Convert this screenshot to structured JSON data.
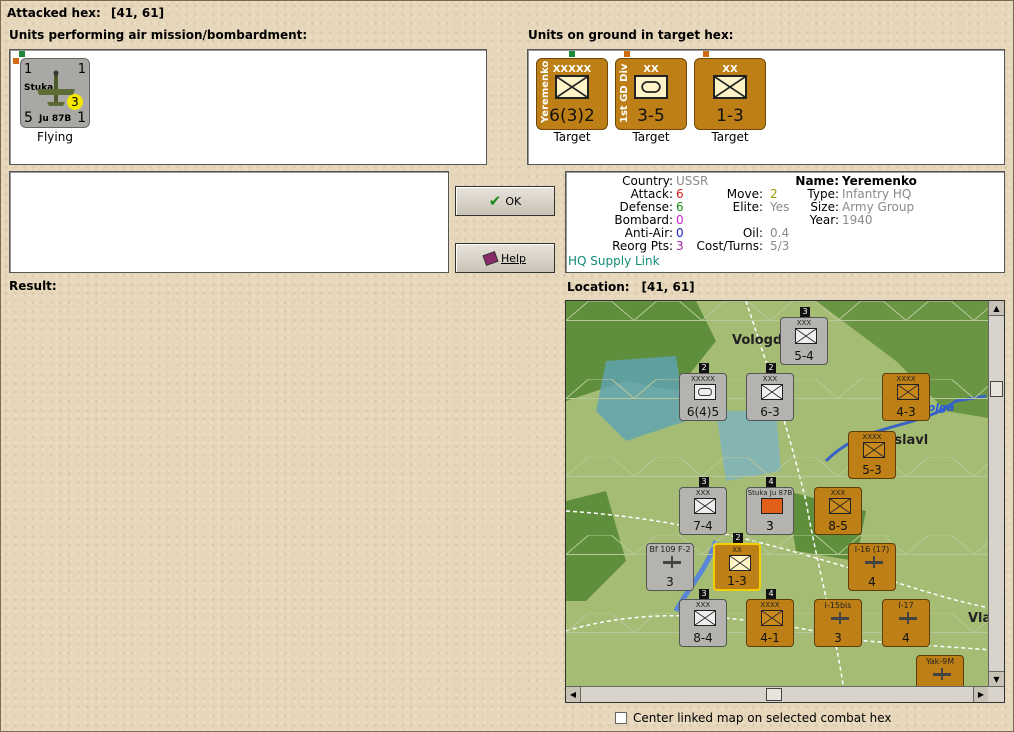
{
  "header": {
    "label": "Attacked hex:",
    "value": "[41, 61]"
  },
  "air": {
    "title": "Units performing air mission/bombardment:",
    "unit": {
      "name": "Stuka",
      "model": "Ju 87B",
      "top_left": "1",
      "top_right": "1",
      "bottom_left": "5",
      "bottom_right": "1",
      "badge": "3",
      "caption": "Flying"
    }
  },
  "ground": {
    "title": "Units on ground in target hex:",
    "units": [
      {
        "side": "Yeremenko",
        "size": "XXXXX",
        "strength": "6(3)2",
        "symbol": "hq",
        "caption": "Target"
      },
      {
        "side": "1st GD Div",
        "size": "XX",
        "strength": "3-5",
        "symbol": "armor",
        "caption": "Target"
      },
      {
        "side": "",
        "size": "XX",
        "strength": "1-3",
        "symbol": "infantry",
        "caption": "Target"
      }
    ]
  },
  "buttons": {
    "ok": "OK",
    "help": "Help"
  },
  "info": {
    "country_label": "Country:",
    "country": "USSR",
    "attack_label": "Attack:",
    "attack": "6",
    "defense_label": "Defense:",
    "defense": "6",
    "bombard_label": "Bombard:",
    "bombard": "0",
    "antiair_label": "Anti-Air:",
    "antiair": "0",
    "reorg_label": "Reorg Pts:",
    "reorg": "3",
    "hq_link": "HQ Supply Link",
    "move_label": "Move:",
    "move": "2",
    "elite_label": "Elite:",
    "elite": "Yes",
    "oil_label": "Oil:",
    "oil": "0.4",
    "cost_label": "Cost/Turns:",
    "cost": "5/3",
    "name_label": "Name:",
    "name": "Yeremenko",
    "type_label": "Type:",
    "type": "Infantry HQ",
    "size_label": "Size:",
    "size": "Army Group",
    "year_label": "Year:",
    "year": "1940"
  },
  "result": {
    "label": "Result:"
  },
  "location": {
    "label": "Location:",
    "value": "[41, 61]"
  },
  "map": {
    "labels": {
      "vologda": "Vologda",
      "yaroslavl": "Yaroslavl",
      "volga": "Volga",
      "vla": "Vla"
    },
    "counters": [
      {
        "id": "c1",
        "strength": "5-4",
        "size": "XXX",
        "color": "gray",
        "stack": "3"
      },
      {
        "id": "c2",
        "strength": "6(4)5",
        "size": "XXXXX",
        "color": "gray",
        "stack": "2"
      },
      {
        "id": "c3",
        "strength": "6-3",
        "size": "XXX",
        "color": "gray",
        "stack": "2"
      },
      {
        "id": "c4",
        "strength": "4-3",
        "size": "XXXX",
        "color": "orange",
        "stack": ""
      },
      {
        "id": "c5",
        "strength": "5-3",
        "size": "XXXX",
        "color": "orange",
        "stack": ""
      },
      {
        "id": "c6",
        "strength": "7-4",
        "size": "XXX",
        "color": "gray",
        "stack": "3"
      },
      {
        "id": "c7",
        "strength": "8-5",
        "size": "XXX",
        "color": "orange",
        "stack": ""
      },
      {
        "id": "c8",
        "strength": "1-3",
        "size": "XX",
        "color": "orange",
        "stack": "2"
      },
      {
        "id": "c9",
        "strength": "8-4",
        "size": "XXX",
        "color": "gray",
        "stack": "3"
      },
      {
        "id": "c10",
        "strength": "4-1",
        "size": "XXXX",
        "color": "orange",
        "stack": "4"
      }
    ],
    "aircraft": [
      {
        "id": "a1",
        "name": "Bf 109 F-2",
        "badge": "3",
        "color": "gray"
      },
      {
        "id": "a2",
        "name": "I-16 (17)",
        "badge": "4",
        "color": "orange"
      },
      {
        "id": "a3",
        "name": "I-15bis",
        "badge": "3",
        "color": "orange"
      },
      {
        "id": "a4",
        "name": "I-17",
        "badge": "4",
        "color": "orange"
      },
      {
        "id": "a5",
        "name": "Yak-9M",
        "badge": "",
        "color": "orange"
      },
      {
        "id": "a6",
        "name": "Stuka Ju 87B",
        "badge": "3",
        "color": "gray"
      }
    ]
  },
  "center_checkbox": {
    "label": "Center linked map on selected combat hex",
    "checked": false
  }
}
